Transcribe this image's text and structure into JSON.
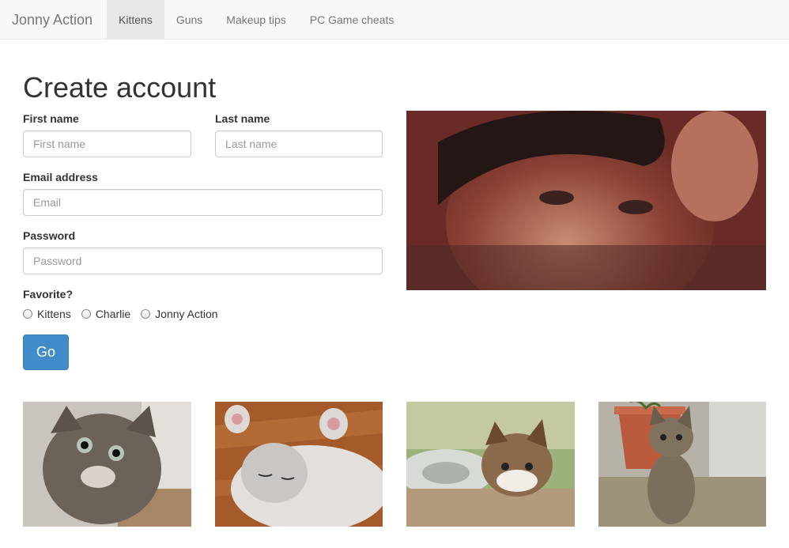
{
  "navbar": {
    "brand": "Jonny Action",
    "items": [
      {
        "label": "Kittens",
        "active": true
      },
      {
        "label": "Guns",
        "active": false
      },
      {
        "label": "Makeup tips",
        "active": false
      },
      {
        "label": "PC Game cheats",
        "active": false
      }
    ]
  },
  "form": {
    "title": "Create account",
    "first_name": {
      "label": "First name",
      "placeholder": "First name",
      "value": ""
    },
    "last_name": {
      "label": "Last name",
      "placeholder": "Last name",
      "value": ""
    },
    "email": {
      "label": "Email address",
      "placeholder": "Email",
      "value": ""
    },
    "password": {
      "label": "Password",
      "placeholder": "Password",
      "value": ""
    },
    "favorite": {
      "label": "Favorite?",
      "options": [
        "Kittens",
        "Charlie",
        "Jonny Action"
      ]
    },
    "submit_label": "Go"
  },
  "colors": {
    "primary_button": "#428bca",
    "navbar_bg": "#f8f8f8",
    "active_tab_bg": "#e7e7e7"
  },
  "images": {
    "portrait": "man-portrait-photo",
    "thumbnails": [
      "kitten-photo-1",
      "kitten-photo-2",
      "kitten-photo-3",
      "kitten-photo-4"
    ]
  }
}
